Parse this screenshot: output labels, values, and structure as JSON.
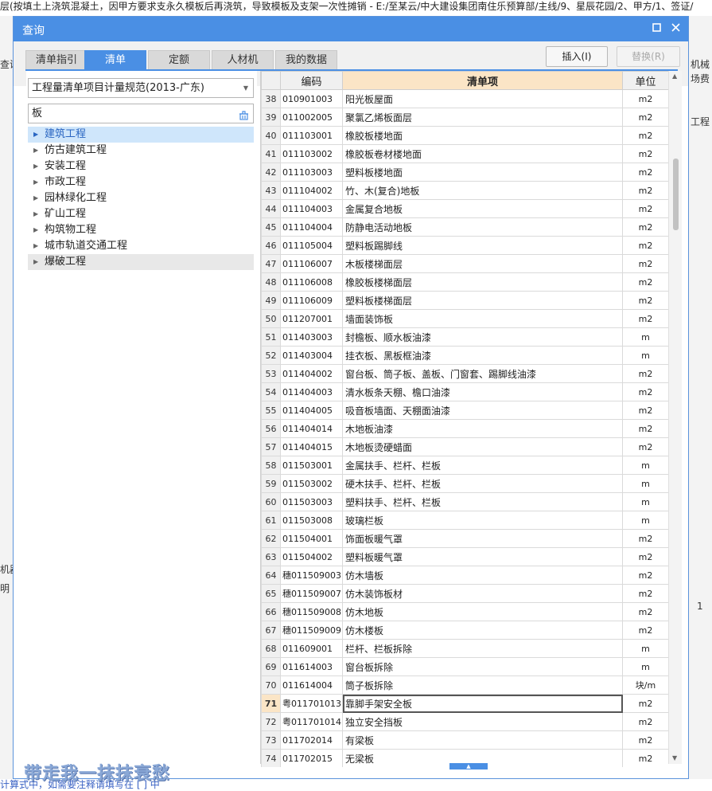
{
  "background": {
    "top_text": "层(按填土上浇筑混凝土，因甲方要求支永久模板后再浇筑，导致模板及支架一次性摊销 - E:/至某云/中大建设集团南住乐预算部/主线/9、星辰花园/2、甲方/1、签证/",
    "left_frags": [
      "查询",
      "机器",
      "明"
    ],
    "right_frags": [
      "机械",
      "场费",
      "工程",
      "1"
    ],
    "bottom_text": "计算式中，如需要注释请填写在 [ ] 中"
  },
  "dialog": {
    "title": "查询",
    "tabs": [
      "清单指引",
      "清单",
      "定额",
      "人材机",
      "我的数据"
    ],
    "active_tab": 1,
    "insert_btn": "插入(I)",
    "replace_btn": "替换(R)",
    "spec_select": "工程量清单项目计量规范(2013-广东)",
    "search_value": "板",
    "tree": [
      {
        "label": "建筑工程",
        "state": "selected"
      },
      {
        "label": "仿古建筑工程",
        "state": ""
      },
      {
        "label": "安装工程",
        "state": ""
      },
      {
        "label": "市政工程",
        "state": ""
      },
      {
        "label": "园林绿化工程",
        "state": ""
      },
      {
        "label": "矿山工程",
        "state": ""
      },
      {
        "label": "构筑物工程",
        "state": ""
      },
      {
        "label": "城市轨道交通工程",
        "state": ""
      },
      {
        "label": "爆破工程",
        "state": "hover"
      }
    ],
    "table": {
      "headers": [
        "",
        "编码",
        "清单项",
        "单位"
      ],
      "current_row": "71",
      "rows": [
        [
          "38",
          "010901003",
          "阳光板屋面",
          "m2"
        ],
        [
          "39",
          "011002005",
          "聚氯乙烯板面层",
          "m2"
        ],
        [
          "40",
          "011103001",
          "橡胶板楼地面",
          "m2"
        ],
        [
          "41",
          "011103002",
          "橡胶板卷材楼地面",
          "m2"
        ],
        [
          "42",
          "011103003",
          "塑料板楼地面",
          "m2"
        ],
        [
          "43",
          "011104002",
          "竹、木(复合)地板",
          "m2"
        ],
        [
          "44",
          "011104003",
          "金属复合地板",
          "m2"
        ],
        [
          "45",
          "011104004",
          "防静电活动地板",
          "m2"
        ],
        [
          "46",
          "011105004",
          "塑料板踢脚线",
          "m2"
        ],
        [
          "47",
          "011106007",
          "木板楼梯面层",
          "m2"
        ],
        [
          "48",
          "011106008",
          "橡胶板楼梯面层",
          "m2"
        ],
        [
          "49",
          "011106009",
          "塑料板楼梯面层",
          "m2"
        ],
        [
          "50",
          "011207001",
          "墙面装饰板",
          "m2"
        ],
        [
          "51",
          "011403003",
          "封檐板、顺水板油漆",
          "m"
        ],
        [
          "52",
          "011403004",
          "挂衣板、黑板框油漆",
          "m"
        ],
        [
          "53",
          "011404002",
          "窗台板、筒子板、盖板、门窗套、踢脚线油漆",
          "m2"
        ],
        [
          "54",
          "011404003",
          "清水板条天棚、檐口油漆",
          "m2"
        ],
        [
          "55",
          "011404005",
          "吸音板墙面、天棚面油漆",
          "m2"
        ],
        [
          "56",
          "011404014",
          "木地板油漆",
          "m2"
        ],
        [
          "57",
          "011404015",
          "木地板烫硬蜡面",
          "m2"
        ],
        [
          "58",
          "011503001",
          "金属扶手、栏杆、栏板",
          "m"
        ],
        [
          "59",
          "011503002",
          "硬木扶手、栏杆、栏板",
          "m"
        ],
        [
          "60",
          "011503003",
          "塑料扶手、栏杆、栏板",
          "m"
        ],
        [
          "61",
          "011503008",
          "玻璃栏板",
          "m"
        ],
        [
          "62",
          "011504001",
          "饰面板暖气罩",
          "m2"
        ],
        [
          "63",
          "011504002",
          "塑料板暖气罩",
          "m2"
        ],
        [
          "64",
          "穗011509003",
          "仿木墙板",
          "m2"
        ],
        [
          "65",
          "穗011509007",
          "仿木装饰板材",
          "m2"
        ],
        [
          "66",
          "穗011509008",
          "仿木地板",
          "m2"
        ],
        [
          "67",
          "穗011509009",
          "仿木楼板",
          "m2"
        ],
        [
          "68",
          "011609001",
          "栏杆、栏板拆除",
          "m"
        ],
        [
          "69",
          "011614003",
          "窗台板拆除",
          "m"
        ],
        [
          "70",
          "011614004",
          "筒子板拆除",
          "块/m"
        ],
        [
          "71",
          "粤011701013",
          "靠脚手架安全板",
          "m2"
        ],
        [
          "72",
          "粤011701014",
          "独立安全挡板",
          "m2"
        ],
        [
          "73",
          "011702014",
          "有梁板",
          "m2"
        ],
        [
          "74",
          "011702015",
          "无梁板",
          "m2"
        ]
      ]
    }
  },
  "watermark": "带走我一抹抹衰愁",
  "colors": {
    "accent": "#4a8fe4",
    "selected_row": "#cfe6fb",
    "header_highlight": "#fbe5c6"
  },
  "icons": {
    "close": "close-icon",
    "maximize": "maximize-icon",
    "clear": "clear-icon",
    "dropdown": "chevron-down-icon"
  }
}
